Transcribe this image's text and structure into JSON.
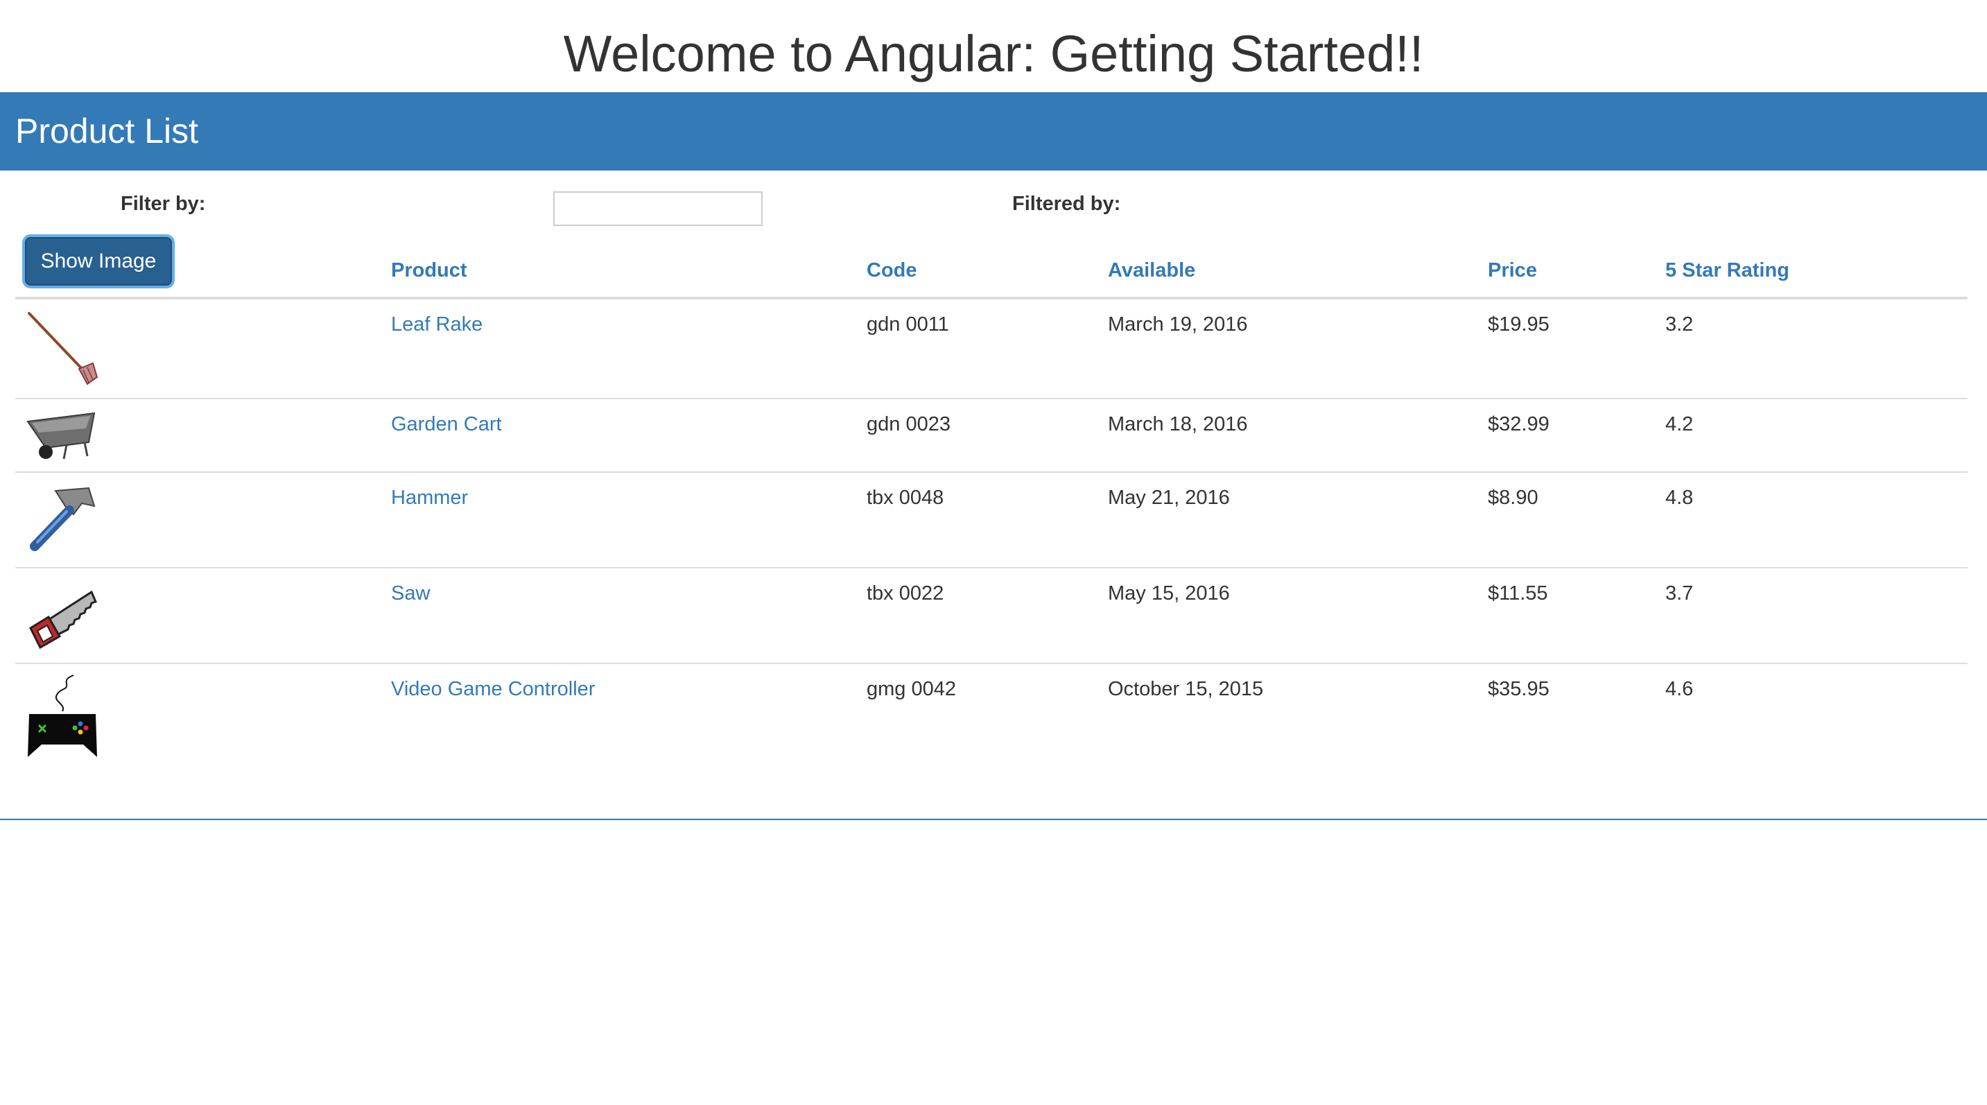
{
  "page": {
    "title": "Welcome to Angular: Getting Started!!"
  },
  "panel": {
    "heading": "Product List"
  },
  "filter": {
    "label": "Filter by:",
    "value": "",
    "filtered_label": "Filtered by:"
  },
  "toolbar": {
    "show_image_label": "Show Image"
  },
  "table": {
    "headers": [
      "Product",
      "Code",
      "Available",
      "Price",
      "5 Star Rating"
    ],
    "rows": [
      {
        "icon": "leaf-rake-icon",
        "name": "Leaf Rake",
        "code": "gdn 0011",
        "available": "March 19, 2016",
        "price": "$19.95",
        "rating": "3.2"
      },
      {
        "icon": "garden-cart-icon",
        "name": "Garden Cart",
        "code": "gdn 0023",
        "available": "March 18, 2016",
        "price": "$32.99",
        "rating": "4.2"
      },
      {
        "icon": "hammer-icon",
        "name": "Hammer",
        "code": "tbx 0048",
        "available": "May 21, 2016",
        "price": "$8.90",
        "rating": "4.8"
      },
      {
        "icon": "saw-icon",
        "name": "Saw",
        "code": "tbx 0022",
        "available": "May 15, 2016",
        "price": "$11.55",
        "rating": "3.7"
      },
      {
        "icon": "video-game-controller-icon",
        "name": "Video Game Controller",
        "code": "gmg 0042",
        "available": "October 15, 2015",
        "price": "$35.95",
        "rating": "4.6"
      }
    ]
  },
  "colors": {
    "accent": "#337ab7",
    "button": "#286090",
    "text": "#333333",
    "rule": "#dddddd"
  }
}
